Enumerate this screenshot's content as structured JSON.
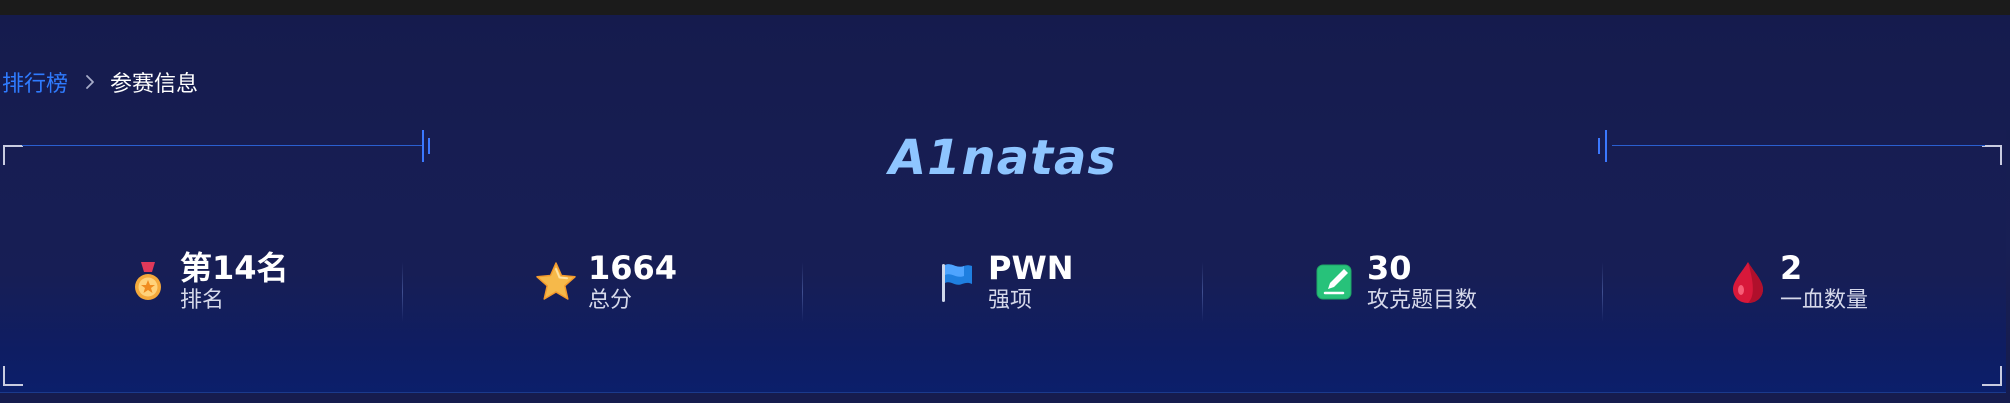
{
  "breadcrumb": {
    "link_label": "排行榜",
    "current_label": "参赛信息"
  },
  "team": {
    "name": "A1natas"
  },
  "stats": [
    {
      "value": "第14名",
      "label": "排名",
      "icon": "medal-icon"
    },
    {
      "value": "1664",
      "label": "总分",
      "icon": "star-icon"
    },
    {
      "value": "PWN",
      "label": "强项",
      "icon": "flag-icon"
    },
    {
      "value": "30",
      "label": "攻克题目数",
      "icon": "edit-icon"
    },
    {
      "value": "2",
      "label": "一血数量",
      "icon": "blood-drop-icon"
    }
  ],
  "colors": {
    "breadcrumb_link": "#2f7bff",
    "team_name": "#8ec5ff",
    "frame_line": "#2a5fd0"
  }
}
